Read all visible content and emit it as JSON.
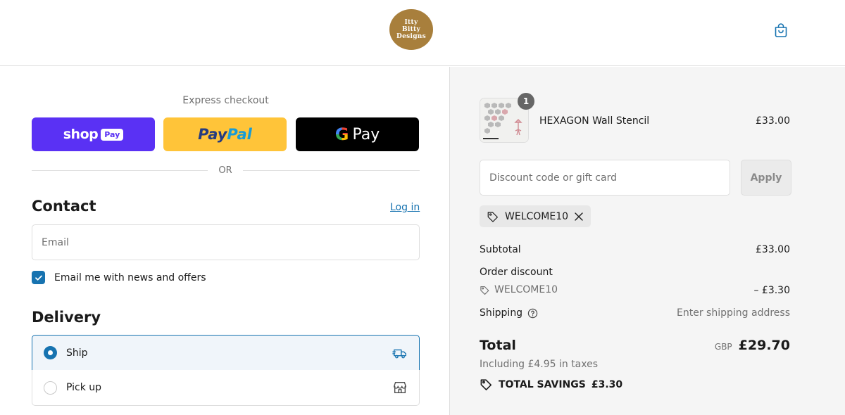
{
  "header": {
    "logo_text": "Itty\nBitty\nDesigns",
    "cart_icon": "shopping-bag-icon"
  },
  "express": {
    "title": "Express checkout",
    "shop_pay": {
      "word": "shop",
      "badge": "Pay"
    },
    "paypal": {
      "pay": "Pay",
      "pal": "Pal"
    },
    "gpay": {
      "g": "G",
      "text": "Pay"
    },
    "divider": "OR"
  },
  "contact": {
    "title": "Contact",
    "login_link": "Log in",
    "email_placeholder": "Email",
    "newsletter_label": "Email me with news and offers",
    "newsletter_checked": true
  },
  "delivery": {
    "title": "Delivery",
    "options": [
      {
        "label": "Ship",
        "selected": true,
        "icon": "truck-icon"
      },
      {
        "label": "Pick up",
        "selected": false,
        "icon": "store-icon"
      }
    ]
  },
  "summary": {
    "product": {
      "name": "HEXAGON Wall Stencil",
      "price": "£33.00",
      "quantity": "1"
    },
    "discount_placeholder": "Discount code or gift card",
    "apply_label": "Apply",
    "applied_code": "WELCOME10",
    "subtotal_label": "Subtotal",
    "subtotal_value": "£33.00",
    "order_discount_label": "Order discount",
    "order_discount_code": "WELCOME10",
    "order_discount_value": "– £3.30",
    "shipping_label": "Shipping",
    "shipping_value": "Enter shipping address",
    "total_label": "Total",
    "currency": "GBP",
    "total_value": "£29.70",
    "taxes_note": "Including £4.95 in taxes",
    "savings_label": "TOTAL SAVINGS",
    "savings_value": "£3.30"
  },
  "colors": {
    "accent": "#1773b0",
    "shop_pay": "#5a31f4",
    "paypal": "#ffc439",
    "logo": "#a87f3c"
  }
}
